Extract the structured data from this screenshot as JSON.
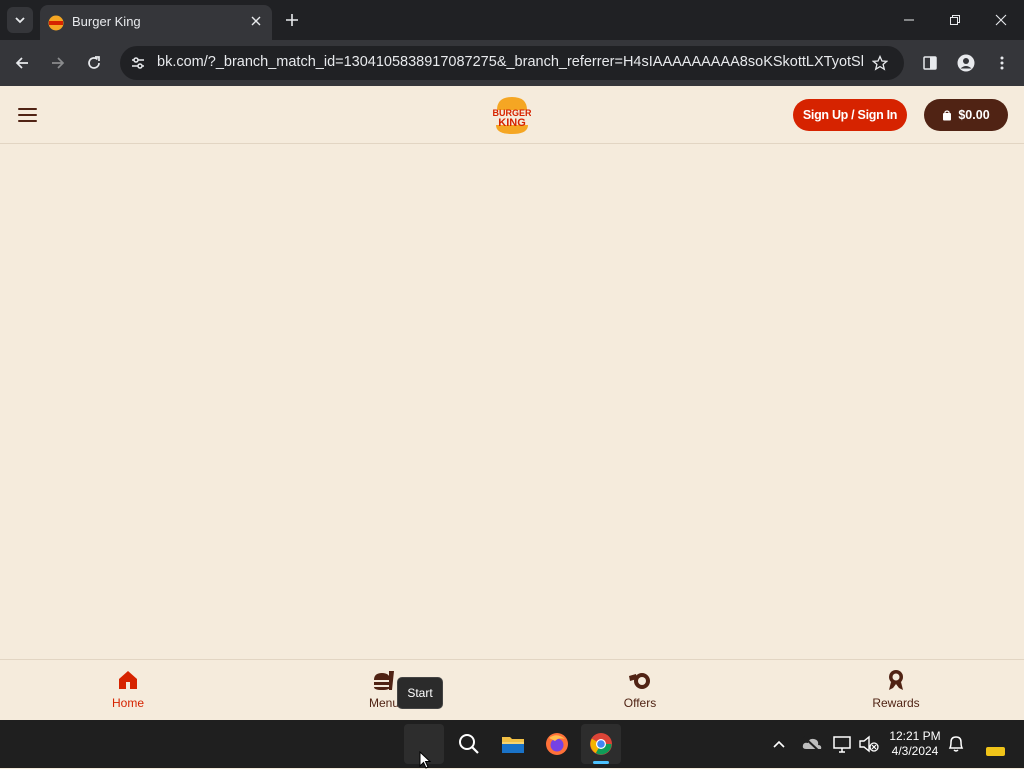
{
  "browser": {
    "tab_title": "Burger King",
    "url": "bk.com/?_branch_match_id=1304105838917087275&_branch_referrer=H4sIAAAAAAAAA8soKSkottLXTyotSk8tys..."
  },
  "header": {
    "signin_label": "Sign Up / Sign In",
    "cart_label": "$0.00",
    "logo_text_top": "BURGER",
    "logo_text_bottom": "KING"
  },
  "bottom_nav": {
    "items": [
      {
        "label": "Home",
        "icon": "home-icon",
        "active": true
      },
      {
        "label": "Menu",
        "icon": "menu-food-icon",
        "active": false
      },
      {
        "label": "Offers",
        "icon": "offers-icon",
        "active": false
      },
      {
        "label": "Rewards",
        "icon": "rewards-icon",
        "active": false
      }
    ]
  },
  "tooltip": {
    "text": "Start"
  },
  "taskbar": {
    "time": "12:21 PM",
    "date": "4/3/2024"
  },
  "colors": {
    "bk_red": "#d62300",
    "bk_brown": "#502314",
    "page_bg": "#f5ebdc"
  }
}
